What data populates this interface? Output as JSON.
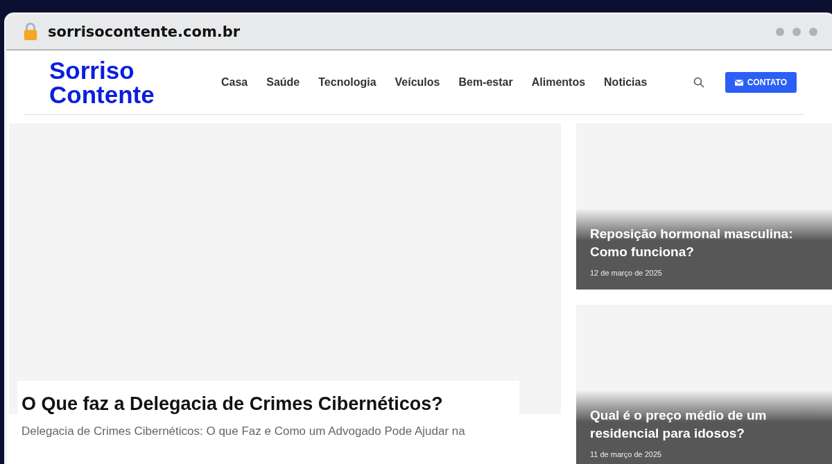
{
  "browser": {
    "url": "sorrisocontente.com.br"
  },
  "site": {
    "logo": "Sorriso Contente",
    "nav": [
      {
        "label": "Casa"
      },
      {
        "label": "Saúde"
      },
      {
        "label": "Tecnologia"
      },
      {
        "label": "Veículos"
      },
      {
        "label": "Bem-estar"
      },
      {
        "label": "Alimentos"
      },
      {
        "label": "Noticias"
      }
    ],
    "contact_button": "CONTATO"
  },
  "main_post": {
    "title": "O Que faz a Delegacia de Crimes Cibernéticos?",
    "excerpt": "Delegacia de Crimes Cibernéticos: O que Faz e Como um Advogado Pode Ajudar na"
  },
  "side_posts": [
    {
      "title": "Reposição hormonal masculina: Como funciona?",
      "date": "12 de março de 2025"
    },
    {
      "title": "Qual é o preço médio de um residencial para idosos?",
      "date": "11 de março de 2025"
    }
  ]
}
